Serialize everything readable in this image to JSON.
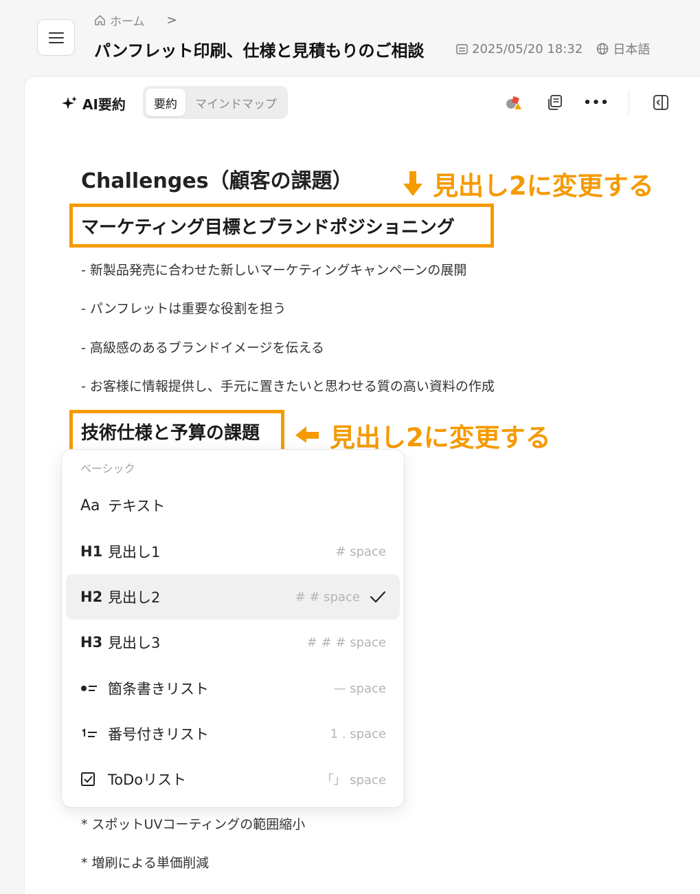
{
  "header": {
    "breadcrumb_home": "ホーム",
    "breadcrumb_sep": ">",
    "title": "パンフレット印刷、仕様と見積もりのご相談",
    "datetime": "2025/05/20 18:32",
    "language": "日本語"
  },
  "toolbar": {
    "ai_label": "AI要約",
    "tabs": [
      {
        "label": "要約",
        "active": true
      },
      {
        "label": "マインドマップ",
        "active": false
      }
    ],
    "more": "•••"
  },
  "content": {
    "section_title": "Challenges（顧客の課題）",
    "annotation_1": "見出し2に変更する",
    "annotation_2": "見出し2に変更する",
    "heading_1": "マーケティング目標とブランドポジショニング",
    "bullets": [
      "- 新製品発売に合わせた新しいマーケティングキャンペーンの展開",
      "- パンフレットは重要な役割を担う",
      "- 高級感のあるブランドイメージを伝える",
      "- お客様に情報提供し、手元に置きたいと思わせる質の高い資料の作成"
    ],
    "heading_2": "技術仕様と予算の課題",
    "bottom_items": [
      "* スポットUVコーティングの範囲縮小",
      "* 増刷による単価削減"
    ]
  },
  "dropdown": {
    "section": "ベーシック",
    "items": [
      {
        "icon": "Aa",
        "label": "テキスト",
        "shortcut": ""
      },
      {
        "icon": "H1",
        "label": "見出し1",
        "shortcut": "# space"
      },
      {
        "icon": "H2",
        "label": "見出し2",
        "shortcut": "# # space",
        "selected": true
      },
      {
        "icon": "H3",
        "label": "見出し3",
        "shortcut": "# # # space"
      },
      {
        "icon": "bullet-list",
        "label": "箇条書きリスト",
        "shortcut": "— space"
      },
      {
        "icon": "numbered-list",
        "label": "番号付きリスト",
        "shortcut": "1 . space"
      },
      {
        "icon": "checkbox",
        "label": "ToDoリスト",
        "shortcut": "「」 space"
      }
    ]
  },
  "colors": {
    "accent": "#f59a00",
    "text": "#1a1a1a",
    "muted": "#8a8a8e"
  }
}
